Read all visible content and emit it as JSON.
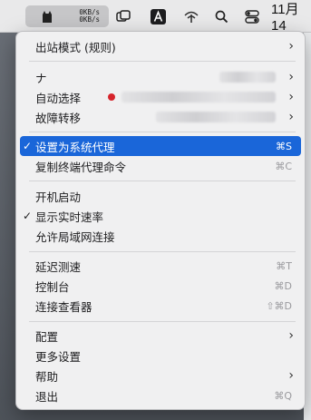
{
  "menubar": {
    "speed_up": "0KB/s",
    "speed_down": "0KB/s",
    "clock": "11月14"
  },
  "menu": {
    "outbound_mode": "出站模式 (规则)",
    "proxy_group_1": "ナ",
    "auto_select": "自动选择",
    "failover": "故障转移",
    "set_system_proxy": "设置为系统代理",
    "set_system_proxy_shortcut": "⌘S",
    "copy_terminal_cmd": "复制终端代理命令",
    "copy_terminal_cmd_shortcut": "⌘C",
    "launch_at_login": "开机启动",
    "show_speed": "显示实时速率",
    "allow_lan": "允许局域网连接",
    "latency_test": "延迟测速",
    "latency_test_shortcut": "⌘T",
    "dashboard": "控制台",
    "dashboard_shortcut": "⌘D",
    "connection_viewer": "连接查看器",
    "connection_viewer_shortcut": "⇧⌘D",
    "config": "配置",
    "more_settings": "更多设置",
    "help": "帮助",
    "quit": "退出",
    "quit_shortcut": "⌘Q",
    "checkmark": "✓",
    "submenu_arrow": "›"
  },
  "colors": {
    "selection": "#1a66d9",
    "menu_bg": "#f0f0f1"
  }
}
